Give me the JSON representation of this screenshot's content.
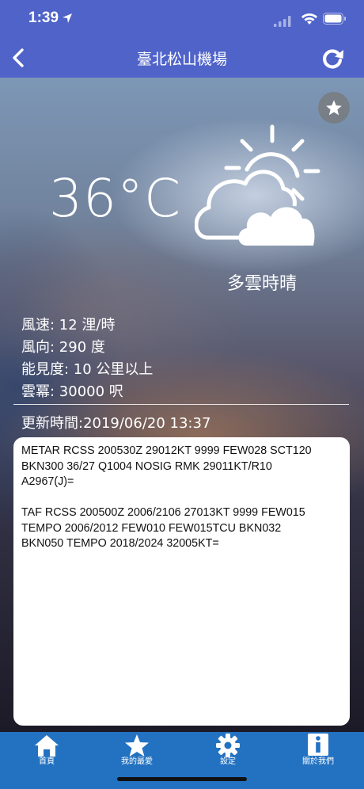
{
  "status": {
    "time": "1:39"
  },
  "nav": {
    "title": "臺北松山機場"
  },
  "weather": {
    "temperature": "36°C",
    "condition": "多雲時晴",
    "wind_speed": "風速: 12 浬/時",
    "wind_direction": "風向: 290 度",
    "visibility": "能見度: 10 公里以上",
    "ceiling": "雲冪: 30000 呎",
    "updated": "更新時間:2019/06/20 13:37"
  },
  "report": {
    "metar_lines": [
      "METAR RCSS 200530Z 29012KT 9999 FEW028 SCT120",
      "BKN300 36/27 Q1004 NOSIG RMK 29011KT/R10",
      "A2967(J)="
    ],
    "taf_lines": [
      "TAF RCSS 200500Z 2006/2106 27013KT 9999 FEW015",
      "TEMPO 2006/2012 FEW010 FEW015TCU BKN032",
      "BKN050 TEMPO 2018/2024 32005KT="
    ]
  },
  "tabs": [
    {
      "label": "首頁",
      "icon": "home-icon"
    },
    {
      "label": "我的最愛",
      "icon": "star-icon"
    },
    {
      "label": "設定",
      "icon": "gear-icon"
    },
    {
      "label": "關於我們",
      "icon": "info-icon"
    }
  ],
  "colors": {
    "nav_bar": "#4f63c9",
    "tab_bar": "#2372c2",
    "report_bg": "#ffffff"
  }
}
